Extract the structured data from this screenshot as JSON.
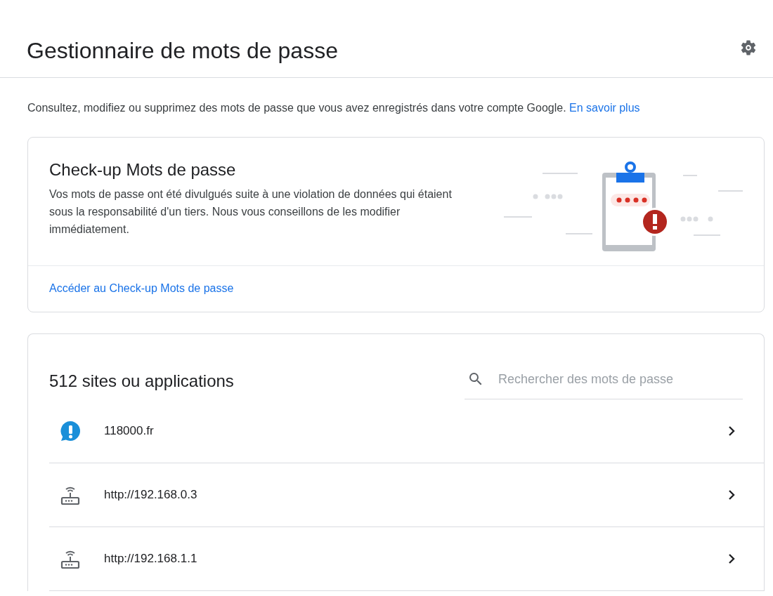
{
  "header": {
    "title": "Gestionnaire de mots de passe"
  },
  "intro": {
    "text": "Consultez, modifiez ou supprimez des mots de passe que vous avez enregistrés dans votre compte Google.",
    "link": "En savoir plus"
  },
  "checkup": {
    "title": "Check-up Mots de passe",
    "text": "Vos mots de passe ont été divulgués suite à une violation de données qui étaient sous la responsabilité d'un tiers. Nous vous conseillons de les modifier immédiatement.",
    "link": "Accéder au Check-up Mots de passe"
  },
  "passwords": {
    "title": "512 sites ou applications",
    "search": {
      "placeholder": "Rechercher des mots de passe"
    },
    "rows": [
      {
        "kind": "alert",
        "site": "118000.fr"
      },
      {
        "kind": "router",
        "site": "http://192.168.0.3"
      },
      {
        "kind": "router",
        "site": "http://192.168.1.1"
      }
    ]
  }
}
